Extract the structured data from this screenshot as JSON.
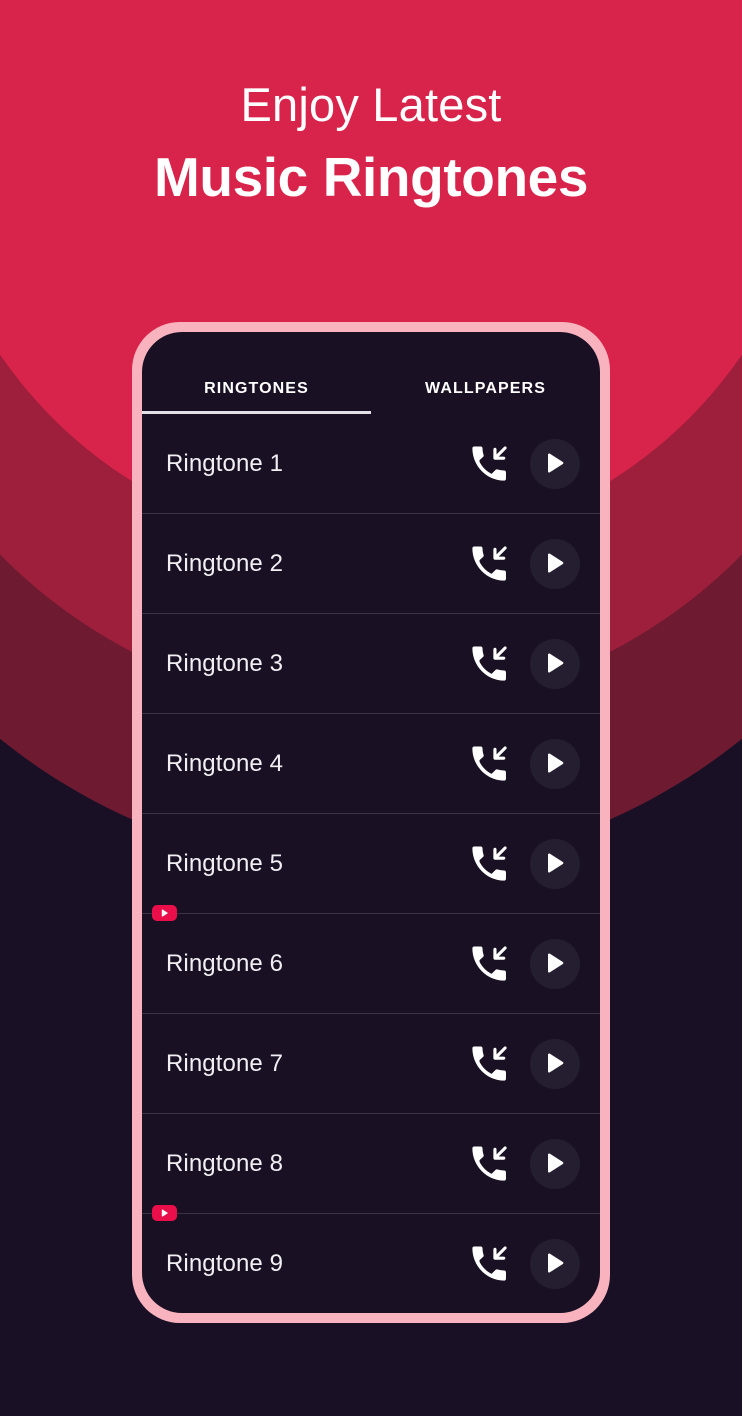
{
  "headline": {
    "line1": "Enjoy Latest",
    "line2": "Music Ringtones"
  },
  "colors": {
    "background_top": "#C82245",
    "arc_inner": "#D8234A",
    "arc_mid": "#9E1F3C",
    "arc_outer": "#6E1A30",
    "page_background": "#1A1025",
    "phone_frame": "#F9B3BE",
    "screen_background": "#191024",
    "row_divider": "#3B3344",
    "badge_red": "#EA0F4A",
    "text_primary": "#F2EFF4"
  },
  "phone": {
    "tabs": [
      {
        "label": "RINGTONES",
        "active": true
      },
      {
        "label": "WALLPAPERS",
        "active": false
      }
    ],
    "list": {
      "rows": [
        {
          "title": "Ringtone 1",
          "assign_icon": "incoming-call-icon",
          "play_icon": "play-icon",
          "ad_badge": false
        },
        {
          "title": "Ringtone 2",
          "assign_icon": "incoming-call-icon",
          "play_icon": "play-icon",
          "ad_badge": false
        },
        {
          "title": "Ringtone 3",
          "assign_icon": "incoming-call-icon",
          "play_icon": "play-icon",
          "ad_badge": false
        },
        {
          "title": "Ringtone 4",
          "assign_icon": "incoming-call-icon",
          "play_icon": "play-icon",
          "ad_badge": false
        },
        {
          "title": "Ringtone 5",
          "assign_icon": "incoming-call-icon",
          "play_icon": "play-icon",
          "ad_badge": false
        },
        {
          "title": "Ringtone 6",
          "assign_icon": "incoming-call-icon",
          "play_icon": "play-icon",
          "ad_badge": true
        },
        {
          "title": "Ringtone 7",
          "assign_icon": "incoming-call-icon",
          "play_icon": "play-icon",
          "ad_badge": false
        },
        {
          "title": "Ringtone 8",
          "assign_icon": "incoming-call-icon",
          "play_icon": "play-icon",
          "ad_badge": false
        },
        {
          "title": "Ringtone 9",
          "assign_icon": "incoming-call-icon",
          "play_icon": "play-icon",
          "ad_badge": true
        }
      ]
    }
  }
}
